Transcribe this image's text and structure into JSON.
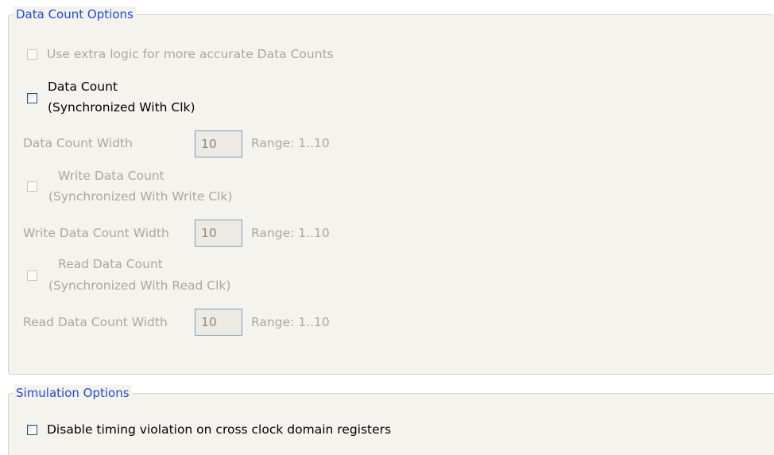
{
  "data_count_group": {
    "legend": "Data Count Options",
    "extra_logic": {
      "label": "Use extra logic for more accurate Data Counts",
      "checked": false,
      "enabled": false
    },
    "data_count": {
      "label_line1": "Data Count",
      "label_line2": "(Synchronized With Clk)",
      "checked": false,
      "enabled": true
    },
    "data_count_width": {
      "label": "Data Count Width",
      "value": "10",
      "range": "Range: 1..10"
    },
    "write_data_count": {
      "label_line1": "Write Data Count",
      "label_line2": "(Synchronized With Write Clk)",
      "checked": false,
      "enabled": false
    },
    "write_data_count_width": {
      "label": "Write Data Count Width",
      "value": "10",
      "range": "Range: 1..10"
    },
    "read_data_count": {
      "label_line1": "Read Data Count",
      "label_line2": "(Synchronized With Read Clk)",
      "checked": false,
      "enabled": false
    },
    "read_data_count_width": {
      "label": "Read Data Count Width",
      "value": "10",
      "range": "Range: 1..10"
    }
  },
  "simulation_group": {
    "legend": "Simulation Options",
    "disable_timing": {
      "label": "Disable timing violation on cross clock domain registers",
      "checked": false,
      "enabled": true
    }
  },
  "colors": {
    "legend_blue": "#1f4bd3",
    "panel_bg": "#f4f3ee",
    "disabled_text": "#aca899"
  }
}
